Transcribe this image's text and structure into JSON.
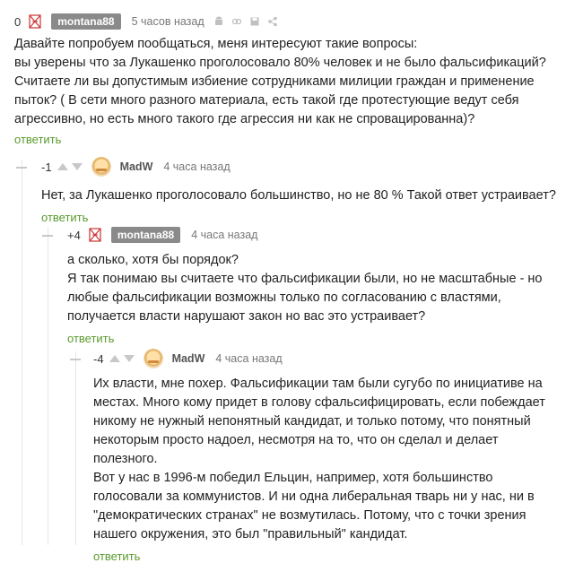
{
  "comments": [
    {
      "rating": "0",
      "user": "montana88",
      "time": "5 часов назад",
      "text": "Давайте попробуем пообщаться, меня интересуют такие вопросы:\nвы уверены что за Лукашенко проголосовало 80% человек и не было фальсификаций?\nСчитаете ли вы допустимым избиение сотрудниками милиции граждан и применение пыток? ( В сети много разного материала, есть такой где протестующие ведут себя агрессивно, но есть много такого где агрессия ни как не спровацированна)?",
      "reply": "ответить"
    },
    {
      "rating": "-1",
      "user": "MadW",
      "time": "4 часа назад",
      "text": "Нет, за Лукашенко проголосовало большинство, но не 80 % Такой ответ устраивает?",
      "reply": "ответить"
    },
    {
      "rating": "+4",
      "user": "montana88",
      "time": "4 часа назад",
      "text": "а сколько, хотя бы порядок?\nЯ так понимаю вы считаете что фальсификации были, но не масштабные - но любые фальсификации возможны только по согласованию с властями, получается власти нарушают закон но вас это устраивает?",
      "reply": "ответить"
    },
    {
      "rating": "-4",
      "user": "MadW",
      "time": "4 часа назад",
      "text": "Их власти, мне похер. Фальсификации там были сугубо по инициативе на местах. Много кому придет в голову сфальсифицировать, если побеждает никому не нужный непонятный кандидат, и только потому, что понятный некоторым просто надоел, несмотря на то, что он сделал и делает полезного.\nВот у нас в 1996-м победил Ельцин, например, хотя большинство голосовали за коммунистов. И ни одна либеральная тварь ни у нас, ни в \"демократических странах\" не возмутилась. Потому, что с точки зрения нашего окружения, это был \"правильный\" кандидат.",
      "reply": "ответить"
    }
  ]
}
